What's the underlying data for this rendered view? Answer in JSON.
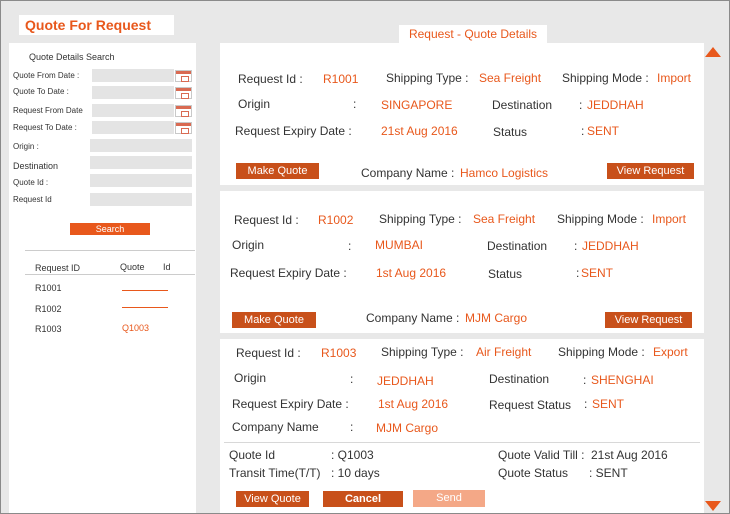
{
  "left": {
    "page_title": "Quote For Request",
    "search_section_title": "Quote Details  Search",
    "fields": [
      {
        "label": "Quote From Date :"
      },
      {
        "label": "Quote To Date :"
      },
      {
        "label": "Request From Date"
      },
      {
        "label": "Request To Date :"
      },
      {
        "label": "Origin :"
      },
      {
        "label": "Destination"
      },
      {
        "label": "Quote Id :"
      },
      {
        "label": "Request Id"
      }
    ],
    "search_button": "Search",
    "table": {
      "headers": [
        "Request ID",
        "Quote",
        "Id"
      ],
      "rows": [
        {
          "request_id": "R1001",
          "quote_id": ""
        },
        {
          "request_id": "R1002",
          "quote_id": ""
        },
        {
          "request_id": "R1003",
          "quote_id": "Q1003"
        }
      ]
    }
  },
  "right": {
    "title": "Request - Quote Details",
    "cards": [
      {
        "request_id_label": "Request Id :",
        "request_id": "R1001",
        "shipping_type_label": "Shipping Type :",
        "shipping_type": "Sea Freight",
        "shipping_mode_label": "Shipping Mode :",
        "shipping_mode": "Import",
        "origin_label": "Origin",
        "origin_colon": ":",
        "origin": "SINGAPORE",
        "destination_label": "Destination",
        "destination_colon": ":",
        "destination": "JEDDHAH",
        "expiry_label": "Request Expiry Date :",
        "expiry": "21st Aug 2016",
        "status_label": "Status",
        "status_colon": ":",
        "status": "SENT",
        "make_quote": "Make Quote",
        "company_label": "Company Name :",
        "company": "Hamco Logistics",
        "view_request": "View Request"
      },
      {
        "request_id_label": "Request Id :",
        "request_id": "R1002",
        "shipping_type_label": "Shipping Type :",
        "shipping_type": "Sea Freight",
        "shipping_mode_label": "Shipping Mode :",
        "shipping_mode": "Import",
        "origin_label": "Origin",
        "origin_colon": ":",
        "origin": "MUMBAI",
        "destination_label": "Destination",
        "destination_colon": ":",
        "destination": "JEDDHAH",
        "expiry_label": "Request Expiry Date :",
        "expiry": "1st Aug 2016",
        "status_label": "Status",
        "status_colon": ":",
        "status": "SENT",
        "make_quote": "Make Quote",
        "company_label": "Company Name :",
        "company": "MJM Cargo",
        "view_request": "View Request"
      },
      {
        "request_id_label": "Request Id :",
        "request_id": "R1003",
        "shipping_type_label": "Shipping Type :",
        "shipping_type": "Air Freight",
        "shipping_mode_label": "Shipping Mode :",
        "shipping_mode": "Export",
        "origin_label": "Origin",
        "origin_colon": ":",
        "origin": "JEDDHAH",
        "destination_label": "Destination",
        "destination_colon": ":",
        "destination": "SHENGHAI",
        "expiry_label": "Request Expiry Date :",
        "expiry": "1st Aug 2016",
        "status_label": "Request Status",
        "status_colon": ":",
        "status": "SENT",
        "company_label": "Company Name",
        "company_colon": ":",
        "company": "MJM Cargo",
        "quote_id_label": "Quote Id",
        "quote_id_value": ": Q1003",
        "transit_label": "Transit Time(T/T)",
        "transit_value": ": 10 days",
        "valid_till_label": "Quote Valid Till :",
        "valid_till_value": "21st Aug 2016",
        "quote_status_label": "Quote Status",
        "quote_status_value": ": SENT",
        "view_quote": "View Quote",
        "cancel": "Cancel",
        "send": "Send"
      }
    ]
  },
  "colors": {
    "accent": "#e8581c",
    "disabled_button": "#f4a887",
    "panel_background": "#e8e8e8",
    "input_background": "#e4e4e4"
  },
  "icons": {
    "scroll_up": "triangle-up",
    "scroll_down": "triangle-down",
    "calendar": "calendar-icon"
  }
}
